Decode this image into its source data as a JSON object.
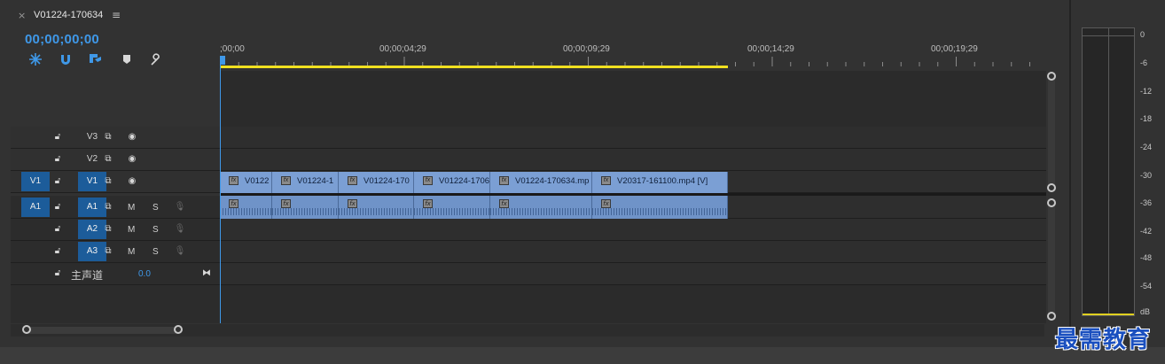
{
  "tab": {
    "close": "×",
    "title": "V01224-170634",
    "menu": "≡"
  },
  "timecode": "00;00;00;00",
  "ruler": {
    "labels": [
      ";00;00",
      "00;00;04;29",
      "00;00;09;29",
      "00;00;14;29",
      "00;00;19;29"
    ]
  },
  "tracks": {
    "v3": "V3",
    "v2": "V2",
    "v1": "V1",
    "v1_src": "V1",
    "a1": "A1",
    "a1_src": "A1",
    "a2": "A2",
    "a3": "A3",
    "mute": "M",
    "solo": "S",
    "master_label": "主声道",
    "master_value": "0.0"
  },
  "video_clips": [
    "V0122",
    "V01224-1",
    "V01224-170",
    "V01224-1706",
    "V01224-170634.mp",
    "V20317-161100.mp4 [V]"
  ],
  "fx_label": "fx",
  "meter": {
    "scale": [
      "0",
      "-6",
      "-12",
      "-18",
      "-24",
      "-30",
      "-36",
      "-42",
      "-48",
      "-54",
      "dB"
    ]
  },
  "watermark": "最需教育",
  "colors": {
    "accent": "#3f98e8",
    "clip": "#7b9fd4",
    "work_area": "#f0e020"
  }
}
